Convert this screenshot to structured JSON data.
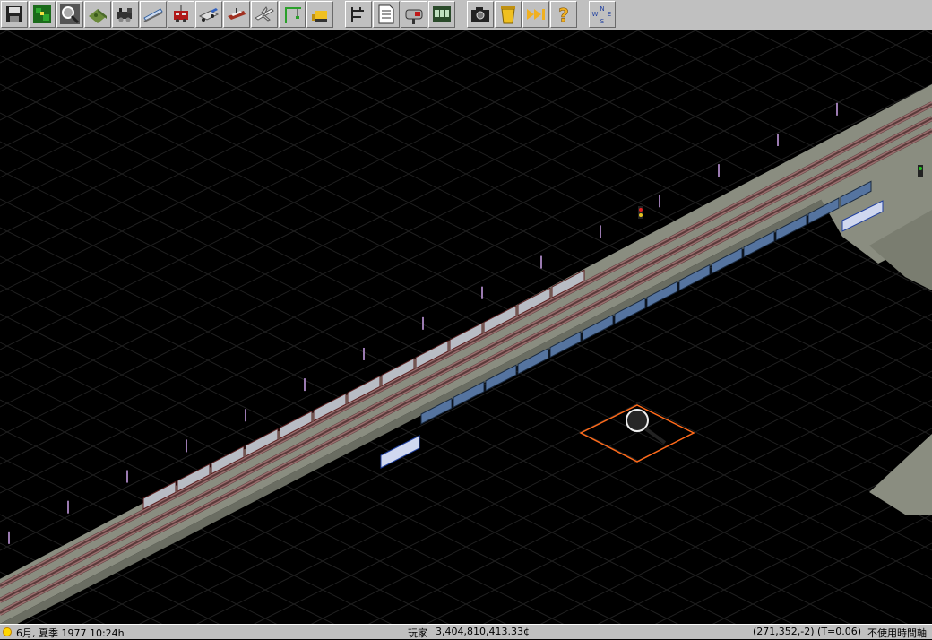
{
  "toolbar": {
    "buttons": [
      {
        "name": "save-icon"
      },
      {
        "name": "minimap-icon"
      },
      {
        "name": "magnifier-icon"
      },
      {
        "name": "terrain-icon"
      },
      {
        "name": "steam-locomotive-icon"
      },
      {
        "name": "monorail-icon"
      },
      {
        "name": "tram-icon"
      },
      {
        "name": "truck-icon"
      },
      {
        "name": "ship-icon"
      },
      {
        "name": "airplane-icon"
      },
      {
        "name": "crane-icon"
      },
      {
        "name": "bulldozer-icon"
      },
      {
        "name": "separator"
      },
      {
        "name": "hierarchy-icon"
      },
      {
        "name": "document-icon"
      },
      {
        "name": "mailbox-icon"
      },
      {
        "name": "list-icon"
      },
      {
        "name": "separator"
      },
      {
        "name": "camera-icon"
      },
      {
        "name": "trash-icon"
      },
      {
        "name": "fast-forward-icon"
      },
      {
        "name": "help-icon"
      },
      {
        "name": "separator"
      },
      {
        "name": "compass-icon"
      }
    ]
  },
  "status": {
    "date": "6月, 夏季 1977 10:24h",
    "player_label": "玩家",
    "money": "3,404,810,413.33¢",
    "coords": "(271,352,-2) (T=0.06)",
    "mode": "不使用時間軸"
  },
  "colors": {
    "background": "#000000",
    "toolbar": "#c0c0c0",
    "embankment": "#8a8d80",
    "rail": "#9a6e6e",
    "passenger_car": "#b8bcc4",
    "freight_car": "#5574a0",
    "cursor_outline": "#ff6a1a"
  }
}
